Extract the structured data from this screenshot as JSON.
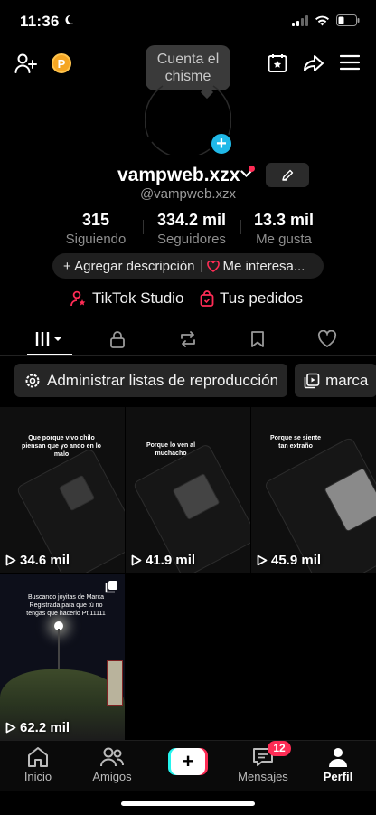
{
  "status": {
    "time": "11:36"
  },
  "tooltip": {
    "text": "Cuenta el chisme"
  },
  "profile": {
    "username": "vampweb.xzx",
    "handle": "@vampweb.xzx",
    "stats": [
      {
        "value": "315",
        "label": "Siguiendo"
      },
      {
        "value": "334.2 mil",
        "label": "Seguidores"
      },
      {
        "value": "13.3 mil",
        "label": "Me gusta"
      }
    ],
    "add_description": "+ Agregar descripción",
    "interests": "Me interesa..."
  },
  "links": {
    "studio": "TikTok Studio",
    "orders": "Tus pedidos"
  },
  "playlists": [
    {
      "label": "Administrar listas de reproducción"
    },
    {
      "label": "marca"
    }
  ],
  "videos": [
    {
      "caption": "Que porque vivo chilo piensan que yo ando en lo malo",
      "views": "34.6 mil"
    },
    {
      "caption": "Porque lo ven al muchacho",
      "views": "41.9 mil"
    },
    {
      "caption": "Porque se siente tan extraño",
      "views": "45.9 mil"
    },
    {
      "caption": "Buscando joyitas de Marca Registrada para que tú no tengas que hacerlo Pt.11111",
      "views": "62.2 mil"
    }
  ],
  "nav": {
    "home": "Inicio",
    "friends": "Amigos",
    "inbox": "Mensajes",
    "inbox_badge": "12",
    "profile": "Perfil"
  },
  "colors": {
    "accent": "#fe2c55",
    "cyan": "#25f4ee",
    "coin": "#f5a623",
    "add": "#20b9e8"
  }
}
